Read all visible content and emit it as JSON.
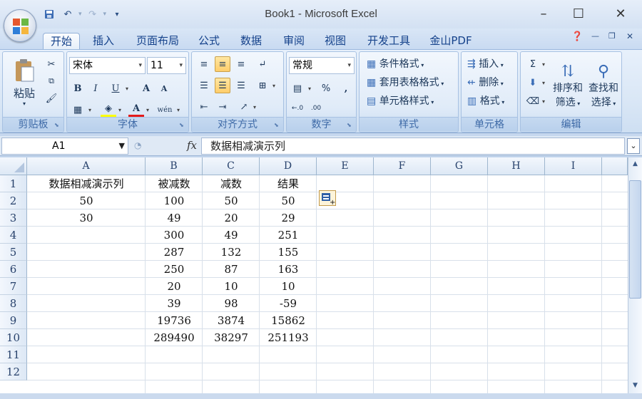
{
  "window": {
    "title": "Book1 - Microsoft Excel",
    "controls": {
      "minimize": "–",
      "maximize": "☐",
      "close": "✕"
    }
  },
  "qat": {
    "save_icon": "save-icon",
    "undo_icon": "undo-icon",
    "redo_icon": "redo-icon"
  },
  "tabs": [
    {
      "label": "开始",
      "active": true
    },
    {
      "label": "插入"
    },
    {
      "label": "页面布局"
    },
    {
      "label": "公式"
    },
    {
      "label": "数据"
    },
    {
      "label": "审阅"
    },
    {
      "label": "视图"
    },
    {
      "label": "开发工具"
    },
    {
      "label": "金山PDF"
    }
  ],
  "ribbon": {
    "clipboard": {
      "label": "剪贴板",
      "paste": "粘贴"
    },
    "font": {
      "label": "字体",
      "name": "宋体",
      "size": "11",
      "bold": "B",
      "italic": "I",
      "underline": "U",
      "grow": "A",
      "shrink": "A",
      "fontcolor": "A",
      "phonetic": "wén"
    },
    "alignment": {
      "label": "对齐方式"
    },
    "number": {
      "label": "数字",
      "format": "常规",
      "percent": "%",
      "comma": ","
    },
    "styles": {
      "label": "样式",
      "conditional": "条件格式",
      "table": "套用表格格式",
      "cell": "单元格样式"
    },
    "cells": {
      "label": "单元格",
      "insert": "插入",
      "delete": "删除",
      "format": "格式"
    },
    "editing": {
      "label": "编辑",
      "sort1": "排序和",
      "sort2": "筛选",
      "find1": "查找和",
      "find2": "选择"
    }
  },
  "formula_bar": {
    "name_box": "A1",
    "fx": "fx",
    "content": "数据相减演示列"
  },
  "grid": {
    "columns": [
      "A",
      "B",
      "C",
      "D",
      "E",
      "F",
      "G",
      "H",
      "I"
    ],
    "rows": [
      "1",
      "2",
      "3",
      "4",
      "5",
      "6",
      "7",
      "8",
      "9",
      "10",
      "11",
      "12"
    ],
    "cells": [
      [
        "数据相减演示列",
        "被减数",
        "减数",
        "结果"
      ],
      [
        "50",
        "100",
        "50",
        "50"
      ],
      [
        "30",
        "49",
        "20",
        "29"
      ],
      [
        "",
        "300",
        "49",
        "251"
      ],
      [
        "",
        "287",
        "132",
        "155"
      ],
      [
        "",
        "250",
        "87",
        "163"
      ],
      [
        "",
        "20",
        "10",
        "10"
      ],
      [
        "",
        "39",
        "98",
        "-59"
      ],
      [
        "",
        "19736",
        "3874",
        "15862"
      ],
      [
        "",
        "289490",
        "38297",
        "251193"
      ]
    ]
  }
}
